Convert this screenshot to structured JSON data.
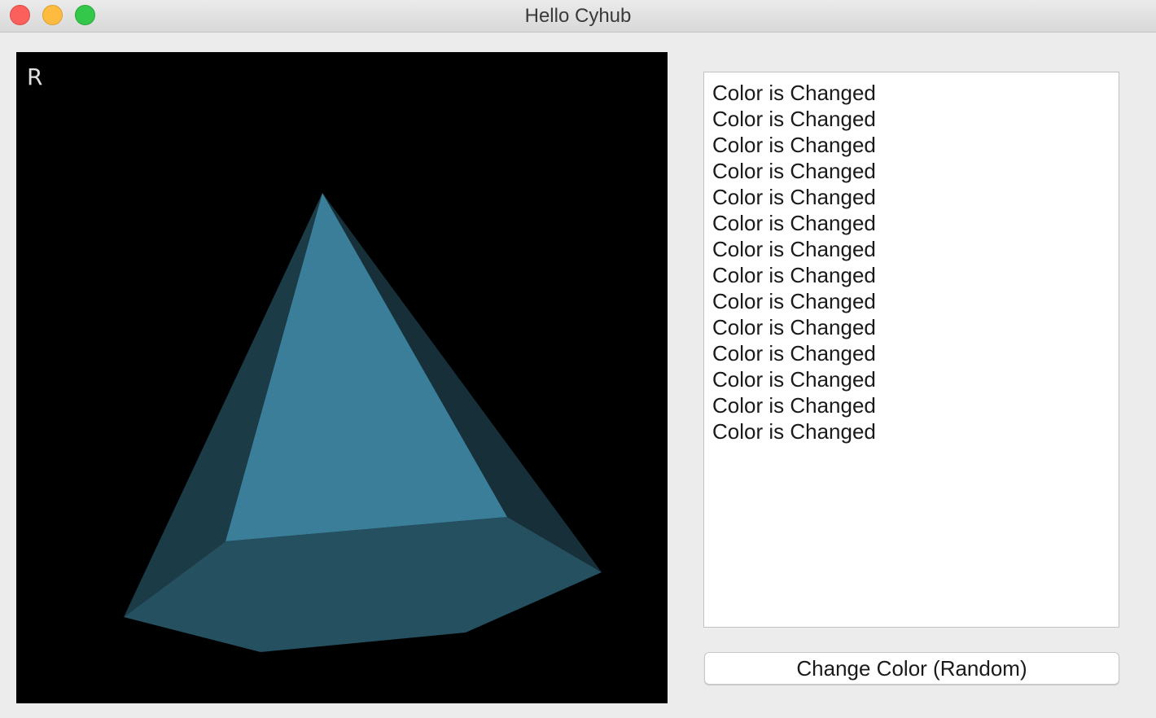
{
  "window": {
    "title": "Hello Cyhub"
  },
  "viewport": {
    "overlay_label": "R",
    "background": "#000000",
    "shape_colors": {
      "front_face": "#3a7e9a",
      "bottom_face": "#25505f",
      "left_face": "#1b3b47",
      "right_face": "#162f38"
    }
  },
  "log": {
    "lines": [
      "Color is Changed",
      "Color is Changed",
      "Color is Changed",
      "Color is Changed",
      "Color is Changed",
      "Color is Changed",
      "Color is Changed",
      "Color is Changed",
      "Color is Changed",
      "Color is Changed",
      "Color is Changed",
      "Color is Changed",
      "Color is Changed",
      "Color is Changed"
    ]
  },
  "controls": {
    "change_color_label": "Change Color (Random)"
  }
}
